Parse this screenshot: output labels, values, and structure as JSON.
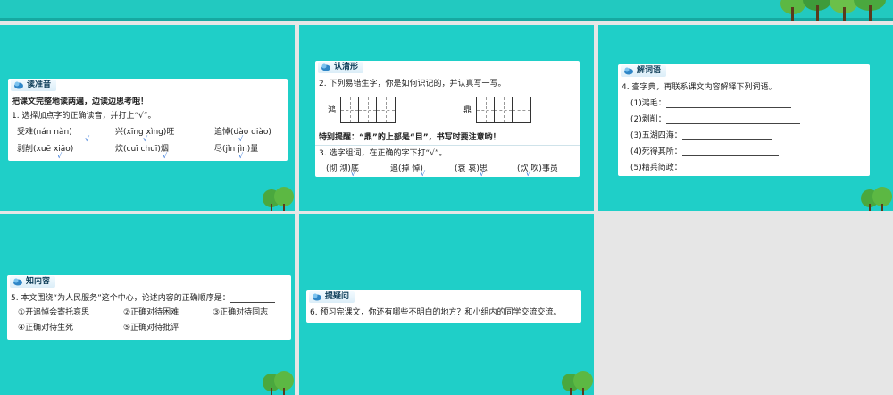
{
  "slide1": {
    "section_label": "读准音",
    "instruction": "把课文完整地读两遍，边读边思考哦！",
    "question": "1. 选择加点字的正确读音，并打上“√”。",
    "rows": [
      [
        "受难(nán  nàn)",
        "兴(xīng  xìng)旺",
        "追悼(dào  diào)"
      ],
      [
        "剥削(xuē  xiāo)",
        "炊(cuī  chuī)烟",
        "尽(jǐn  jìn)量"
      ]
    ]
  },
  "slide2": {
    "section_label": "认清形",
    "question2": "2. 下列易错生字，你是如何识记的，并认真写一写。",
    "char1": "鸿",
    "char2": "鼎",
    "tip_label": "特别提醒：",
    "tip_text": "“鼎”的上部是“目”，书写时要注意哟！",
    "question3": "3. 选字组词，在正确的字下打“√”。",
    "words": [
      "(彻  沏)底",
      "追(掉  悼)",
      "(衰  哀)思",
      "(炊  吹)事员"
    ]
  },
  "slide3": {
    "section_label": "解词语",
    "question": "4. 查字典，再联系课文内容解释下列词语。",
    "items": [
      "(1)鸿毛：",
      "(2)剥削：",
      "(3)五湖四海：",
      "(4)死得其所：",
      "(5)精兵简政："
    ]
  },
  "slide4": {
    "section_label": "知内容",
    "question": "5. 本文围绕“为人民服务”这个中心，论述内容的正确顺序是：",
    "options": [
      "①开追悼会寄托哀思",
      "②正确对待困难",
      "③正确对待同志",
      "④正确对待生死",
      "⑤正确对待批评"
    ]
  },
  "slide5": {
    "section_label": "提疑问",
    "question": "6. 预习完课文，你还有哪些不明白的地方？和小组内的同学交流交流。"
  },
  "colors": {
    "slide_bg": "#1fcfc8",
    "banner": "#22c9c0",
    "card": "#ffffff",
    "tick": "#2a6fd6",
    "tree_leaf": "#3e9b3a",
    "tree_trunk": "#5a3a1c"
  }
}
